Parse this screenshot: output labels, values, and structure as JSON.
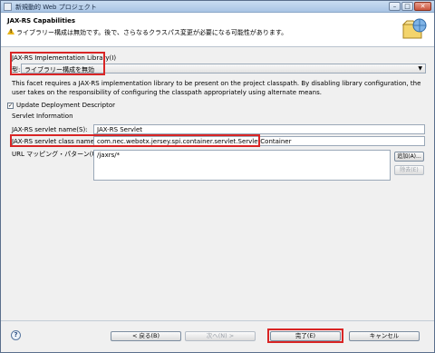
{
  "window": {
    "title": "新規動的 Web プロジェクト"
  },
  "header": {
    "title": "JAX-RS Capabilities",
    "message": "ライブラリー構成は無効です。後で、さらなるクラスパス変更が必要になる可能性があります。"
  },
  "implementation": {
    "label": "JAX-RS Implementation Library(I)",
    "type_label": "型:",
    "type_value": "ライブラリー構成を無効"
  },
  "description": "This facet requires a JAX-RS implementation library to be present on the project classpath. By disabling library configuration, the user takes on the responsibility of configuring the classpath appropriately using alternate means.",
  "deployment": {
    "label": "Update Deployment Descriptor",
    "checked": true
  },
  "servlet": {
    "group_label": "Servlet Information",
    "name_label": "JAX-RS servlet name(S):",
    "name_value": "JAX-RS Servlet",
    "class_label": "JAX-RS servlet class name(L):",
    "class_value": "com.nec.webotx.jersey.spi.container.servlet.ServletContainer",
    "url_label": "URL マッピング・パターン(U):",
    "url_value": "/jaxrs/*",
    "add_label": "追加(A)...",
    "remove_label": "除去(E)"
  },
  "footer": {
    "help": "?",
    "back": "< 戻る(B)",
    "next": "次へ(N) >",
    "finish": "完了(E)",
    "cancel": "キャンセル"
  },
  "colors": {
    "highlight": "#d92525",
    "warning": "#e8b418"
  },
  "icons": [
    "window-icon",
    "warning-icon",
    "folder-globe-icon",
    "chevron-down-icon",
    "checkmark-icon",
    "help-icon"
  ]
}
